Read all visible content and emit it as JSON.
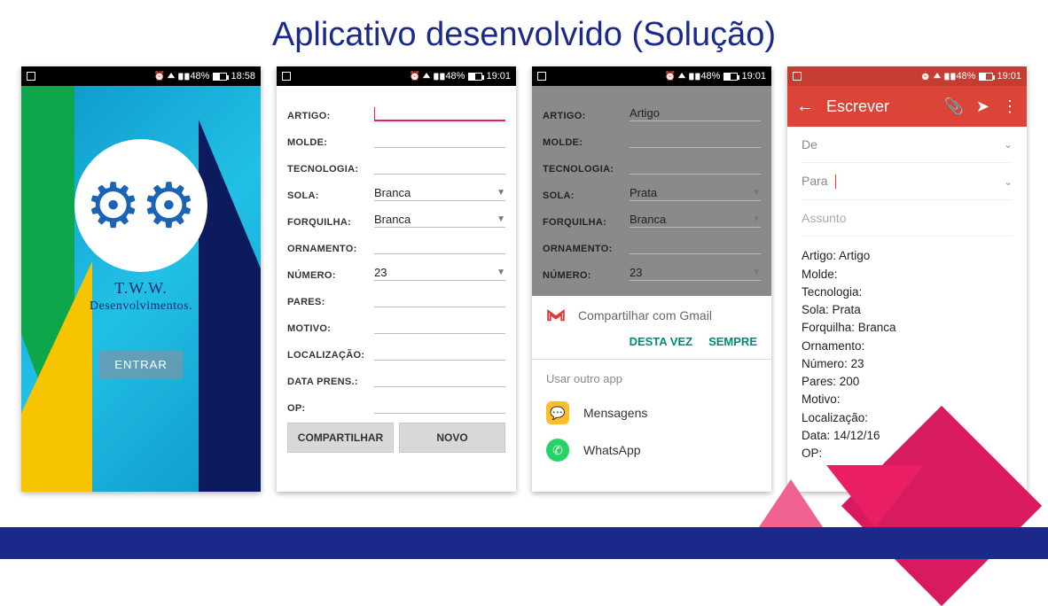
{
  "title": "Aplicativo desenvolvido (Solução)",
  "statusbar": {
    "battery_pct": "48%",
    "time1": "18:58",
    "time2": "19:01",
    "time3": "19:01",
    "time4": "19:01"
  },
  "splash": {
    "brand_line1": "T.W.W.",
    "brand_line2": "Desenvolvimentos.",
    "enter_label": "ENTRAR"
  },
  "form": {
    "labels": {
      "artigo": "ARTIGO:",
      "molde": "MOLDE:",
      "tecnologia": "TECNOLOGIA:",
      "sola": "SOLA:",
      "forquilha": "FORQUILHA:",
      "ornamento": "ORNAMENTO:",
      "numero": "NÚMERO:",
      "pares": "PARES:",
      "motivo": "MOTIVO:",
      "localizacao": "LOCALIZAÇÃO:",
      "data_prens": "DATA PRENS.:",
      "op": "OP:"
    },
    "screen2": {
      "artigo": "",
      "molde": "",
      "tecnologia": "",
      "sola": "Branca",
      "forquilha": "Branca",
      "ornamento": "",
      "numero": "23",
      "pares": "",
      "motivo": "",
      "localizacao": "",
      "data_prens": "",
      "op": ""
    },
    "screen3": {
      "artigo": "Artigo",
      "molde": "",
      "tecnologia": "",
      "sola": "Prata",
      "forquilha": "Branca",
      "ornamento": "",
      "numero": "23"
    },
    "buttons": {
      "compartilhar": "COMPARTILHAR",
      "novo": "NOVO"
    }
  },
  "share_sheet": {
    "gmail_label": "Compartilhar com Gmail",
    "action_once": "DESTA VEZ",
    "action_always": "SEMPRE",
    "other_app_label": "Usar outro app",
    "apps": {
      "mensagens": "Mensagens",
      "whatsapp": "WhatsApp"
    }
  },
  "gmail": {
    "toolbar_title": "Escrever",
    "from_label": "De",
    "to_label": "Para",
    "subject_placeholder": "Assunto",
    "body": "Artigo: Artigo\nMolde:\nTecnologia:\nSola: Prata\nForquilha: Branca\nOrnamento:\nNúmero: 23\nPares: 200\nMotivo:\nLocalização:\nData: 14/12/16\nOP:"
  }
}
